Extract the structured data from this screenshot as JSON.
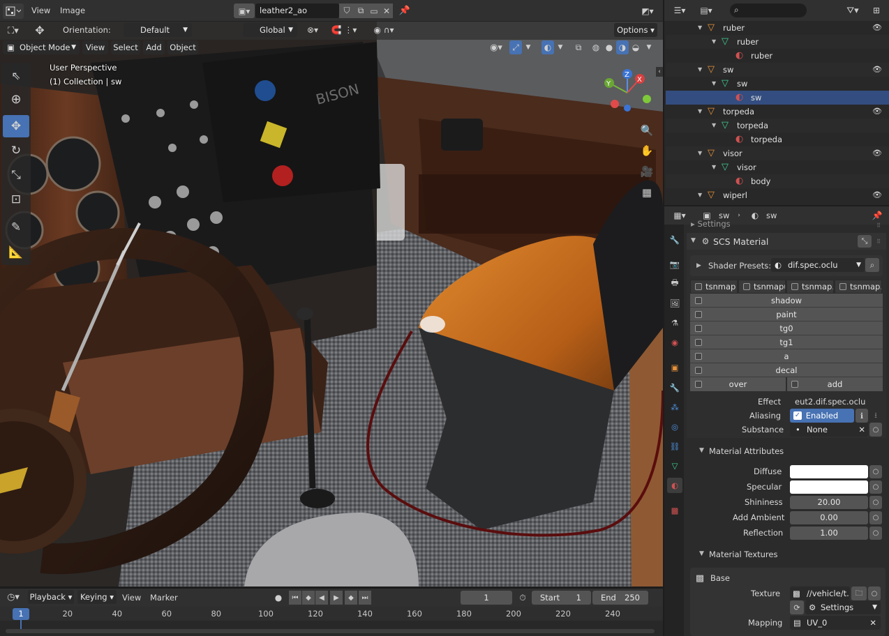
{
  "image_editor": {
    "menu_view": "View",
    "menu_image": "Image",
    "image_name": "leather2_ao"
  },
  "viewport": {
    "orientation_label": "Orientation:",
    "orientation_value": "Default",
    "transform_space": "Global",
    "options_label": "Options",
    "mode": "Object Mode",
    "menu_view": "View",
    "menu_select": "Select",
    "menu_add": "Add",
    "menu_object": "Object",
    "perspective": "User Perspective",
    "collection": "(1) Collection | sw",
    "gizmo_x": "X",
    "gizmo_y": "Y",
    "gizmo_z": "Z"
  },
  "outliner": {
    "items": [
      {
        "label": "ruber",
        "type": "object",
        "depth": 0,
        "eye": true,
        "selected": false
      },
      {
        "label": "ruber",
        "type": "mesh",
        "depth": 1,
        "eye": false,
        "selected": false
      },
      {
        "label": "ruber",
        "type": "material",
        "depth": 2,
        "eye": false,
        "selected": false
      },
      {
        "label": "sw",
        "type": "object",
        "depth": 0,
        "eye": true,
        "selected": false
      },
      {
        "label": "sw",
        "type": "mesh",
        "depth": 1,
        "eye": false,
        "selected": false
      },
      {
        "label": "sw",
        "type": "material",
        "depth": 2,
        "eye": false,
        "selected": true
      },
      {
        "label": "torpeda",
        "type": "object",
        "depth": 0,
        "eye": true,
        "selected": false
      },
      {
        "label": "torpeda",
        "type": "mesh",
        "depth": 1,
        "eye": false,
        "selected": false
      },
      {
        "label": "torpeda",
        "type": "material",
        "depth": 2,
        "eye": false,
        "selected": false
      },
      {
        "label": "visor",
        "type": "object",
        "depth": 0,
        "eye": true,
        "selected": false
      },
      {
        "label": "visor",
        "type": "mesh",
        "depth": 1,
        "eye": false,
        "selected": false
      },
      {
        "label": "body",
        "type": "material",
        "depth": 2,
        "eye": false,
        "selected": false
      },
      {
        "label": "wiperl",
        "type": "object",
        "depth": 0,
        "eye": true,
        "selected": false
      }
    ]
  },
  "properties": {
    "breadcrumb_object": "sw",
    "breadcrumb_material": "sw",
    "settings_label": "Settings",
    "panel_title": "SCS Material",
    "shader_presets_label": "Shader Presets:",
    "shader_preset_value": "dif.spec.oclu",
    "flag_tabs": [
      "tsnmap",
      "tsnmapuv",
      "tsnmap...",
      "tsnmap..."
    ],
    "flags": [
      "shadow",
      "paint",
      "tg0",
      "tg1",
      "a",
      "decal"
    ],
    "flag_over": "over",
    "flag_add": "add",
    "effect_label": "Effect",
    "effect_value": "eut2.dif.spec.oclu",
    "aliasing_label": "Aliasing",
    "aliasing_value": "Enabled",
    "substance_label": "Substance",
    "substance_value": "None",
    "attributes_title": "Material Attributes",
    "diffuse_label": "Diffuse",
    "specular_label": "Specular",
    "shininess_label": "Shininess",
    "shininess_value": "20.00",
    "add_ambient_label": "Add Ambient",
    "add_ambient_value": "0.00",
    "reflection_label": "Reflection",
    "reflection_value": "1.00",
    "textures_title": "Material Textures",
    "base_label": "Base",
    "texture_label": "Texture",
    "texture_value": "//vehicle/t...",
    "settings_value": "Settings",
    "mapping_label": "Mapping",
    "mapping_value": "UV_0"
  },
  "timeline": {
    "playback": "Playback",
    "keying": "Keying",
    "view": "View",
    "marker": "Marker",
    "current_frame": "1",
    "start_label": "Start",
    "start_value": "1",
    "end_label": "End",
    "end_value": "250",
    "playhead": "1",
    "ticks": [
      "20",
      "40",
      "60",
      "80",
      "100",
      "120",
      "140",
      "160",
      "180",
      "200",
      "220",
      "240"
    ]
  },
  "colors": {
    "accent": "#4772b3",
    "selected_row": "#334d80",
    "object_icon": "#e8923a",
    "mesh_icon": "#3fcf92",
    "material_icon": "#d15151",
    "enabled_blue": "#4772b3"
  }
}
